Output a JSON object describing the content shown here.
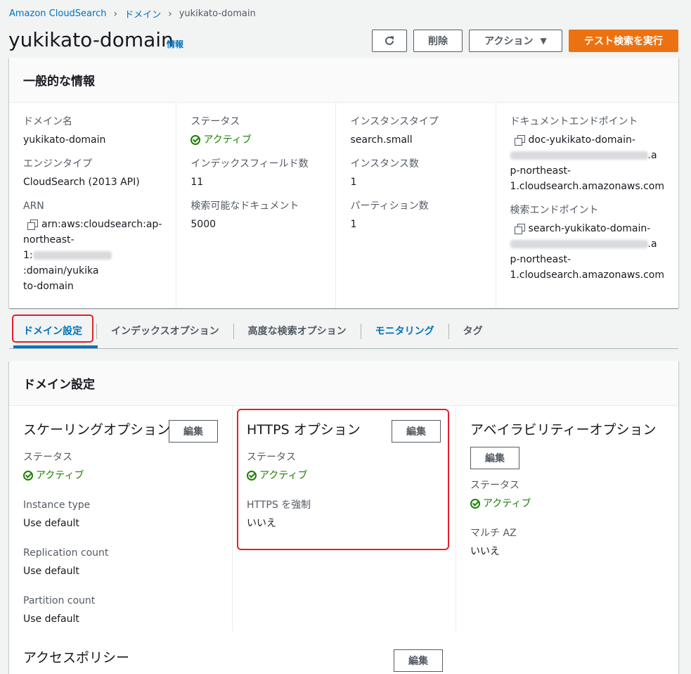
{
  "breadcrumb": [
    "Amazon CloudSearch",
    "ドメイン",
    "yukikato-domain"
  ],
  "header": {
    "title": "yukikato-domain",
    "info": "情報",
    "delete_label": "削除",
    "actions_label": "アクション",
    "test_search_label": "テスト検索を実行"
  },
  "general": {
    "title": "一般的な情報",
    "domain_name_label": "ドメイン名",
    "domain_name": "yukikato-domain",
    "engine_type_label": "エンジンタイプ",
    "engine_type": "CloudSearch (2013 API)",
    "arn_label": "ARN",
    "arn_line1": "arn:aws:cloudsearch:ap-",
    "arn_line2": "northeast-",
    "arn_line3_prefix": "1:",
    "arn_line3_suffix": ":domain/yukika",
    "arn_line4": "to-domain",
    "status_label": "ステータス",
    "status": "アクティブ",
    "index_fields_label": "インデックスフィールド数",
    "index_fields": "11",
    "searchable_docs_label": "検索可能なドキュメント",
    "searchable_docs": "5000",
    "instance_type_label": "インスタンスタイプ",
    "instance_type": "search.small",
    "instance_count_label": "インスタンス数",
    "instance_count": "1",
    "partition_count_label": "パーティション数",
    "partition_count": "1",
    "doc_endpoint_label": "ドキュメントエンドポイント",
    "doc_endpoint_line1": "doc-yukikato-domain-",
    "doc_endpoint_suffix": ".a",
    "doc_endpoint_line3": "p-northeast-",
    "doc_endpoint_line4": "1.cloudsearch.amazonaws.com",
    "search_endpoint_label": "検索エンドポイント",
    "search_endpoint_line1": "search-yukikato-domain-",
    "search_endpoint_suffix": ".a",
    "search_endpoint_line3": "p-northeast-",
    "search_endpoint_line4": "1.cloudsearch.amazonaws.com"
  },
  "tabs": [
    "ドメイン設定",
    "インデックスオプション",
    "高度な検索オプション",
    "モニタリング",
    "タグ"
  ],
  "settings": {
    "title": "ドメイン設定",
    "edit_label": "編集",
    "scaling": {
      "title": "スケーリングオプション",
      "status_label": "ステータス",
      "status": "アクティブ",
      "instance_type_label": "Instance type",
      "instance_type": "Use default",
      "replication_label": "Replication count",
      "replication": "Use default",
      "partition_label": "Partition count",
      "partition": "Use default"
    },
    "https": {
      "title": "HTTPS オプション",
      "status_label": "ステータス",
      "status": "アクティブ",
      "enforce_label": "HTTPS を強制",
      "enforce": "いいえ"
    },
    "availability": {
      "title": "アベイラビリティーオプション",
      "status_label": "ステータス",
      "status": "アクティブ",
      "multi_az_label": "マルチ AZ",
      "multi_az": "いいえ"
    },
    "access_policy_title": "アクセスポリシー"
  }
}
